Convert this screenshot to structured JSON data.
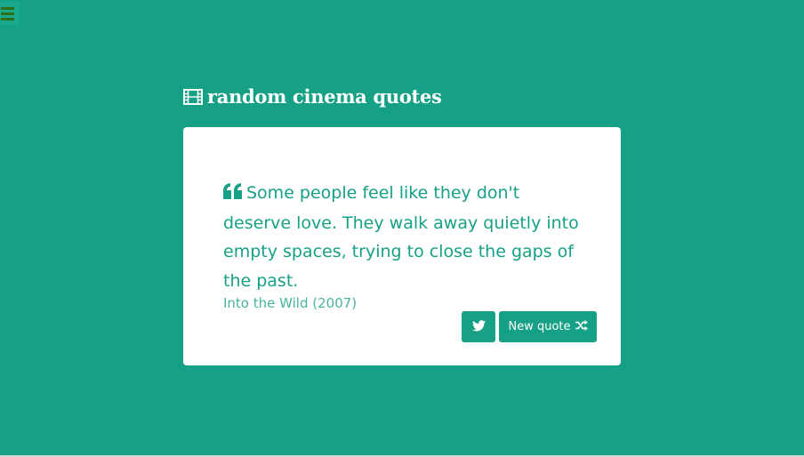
{
  "header": {
    "title": "random cinema quotes",
    "title_icon": "film-icon"
  },
  "menu": {
    "icon": "hamburger-menu-icon"
  },
  "quote": {
    "icon": "quote-left-icon",
    "text": "Some people feel like they don't deserve love. They walk away quietly into empty spaces, trying to close the gaps of the past.",
    "author": "Into the Wild (2007)"
  },
  "actions": {
    "tweet_icon": "twitter-icon",
    "new_quote_label": "New quote",
    "new_quote_icon": "shuffle-icon"
  },
  "colors": {
    "background": "#16a085",
    "card": "#ffffff",
    "accent": "#16a085",
    "menu_bars": "#2e6f15"
  }
}
